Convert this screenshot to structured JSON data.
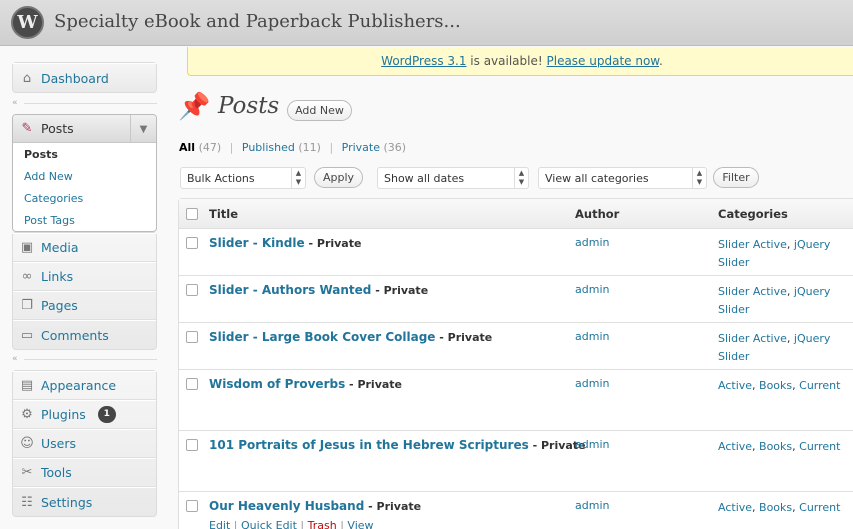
{
  "header": {
    "site_title": "Specialty eBook and Paperback Publishers...",
    "logo": "W"
  },
  "update_nag": {
    "version_link": "WordPress 3.1",
    "middle_text": " is available! ",
    "update_link": "Please update now",
    "end_text": "."
  },
  "sidebar": {
    "dashboard": {
      "label": "Dashboard",
      "icon": "dashboard-icon"
    },
    "posts": {
      "label": "Posts",
      "icon": "pushpin-icon",
      "submenu": [
        "Posts",
        "Add New",
        "Categories",
        "Post Tags"
      ]
    },
    "group2": [
      {
        "label": "Media",
        "icon": "media-icon"
      },
      {
        "label": "Links",
        "icon": "links-icon"
      },
      {
        "label": "Pages",
        "icon": "pages-icon"
      },
      {
        "label": "Comments",
        "icon": "comments-icon"
      }
    ],
    "group3": [
      {
        "label": "Appearance",
        "icon": "appearance-icon"
      },
      {
        "label": "Plugins",
        "icon": "plugins-icon",
        "badge": "1"
      },
      {
        "label": "Users",
        "icon": "users-icon"
      },
      {
        "label": "Tools",
        "icon": "tools-icon"
      },
      {
        "label": "Settings",
        "icon": "settings-icon"
      }
    ]
  },
  "main": {
    "title": "Posts",
    "add_new": "Add New",
    "filters": {
      "all": "All",
      "all_count": "(47)",
      "published": "Published",
      "published_count": "(11)",
      "private": "Private",
      "private_count": "(36)",
      "separator": "|"
    },
    "toolbar": {
      "bulk_actions": "Bulk Actions",
      "apply": "Apply",
      "dates": "Show all dates",
      "categories": "View all categories",
      "filter": "Filter"
    },
    "table": {
      "columns": {
        "title": "Title",
        "author": "Author",
        "categories": "Categories"
      },
      "rows": [
        {
          "title": "Slider - Kindle",
          "state": " - Private",
          "author": "admin",
          "cats": [
            "Slider Active",
            "jQuery Slider"
          ]
        },
        {
          "title": "Slider - Authors Wanted",
          "state": " - Private",
          "author": "admin",
          "cats": [
            "Slider Active",
            "jQuery Slider"
          ]
        },
        {
          "title": "Slider - Large Book Cover Collage",
          "state": " - Private",
          "author": "admin",
          "cats": [
            "Slider Active",
            "jQuery Slider"
          ]
        },
        {
          "title": "Wisdom of Proverbs",
          "state": " - Private",
          "author": "admin",
          "cats": [
            "Active",
            "Books",
            "Current"
          ]
        },
        {
          "title": "101 Portraits of Jesus in the Hebrew Scriptures",
          "state": " - Private",
          "author": "admin",
          "cats": [
            "Active",
            "Books",
            "Current"
          ]
        },
        {
          "title": "Our Heavenly Husband",
          "state": " - Private",
          "author": "admin",
          "cats": [
            "Active",
            "Books",
            "Current"
          ]
        }
      ],
      "row_actions": {
        "edit": "Edit",
        "quick_edit": "Quick Edit",
        "trash": "Trash",
        "view": "View",
        "separator": " | "
      }
    }
  }
}
